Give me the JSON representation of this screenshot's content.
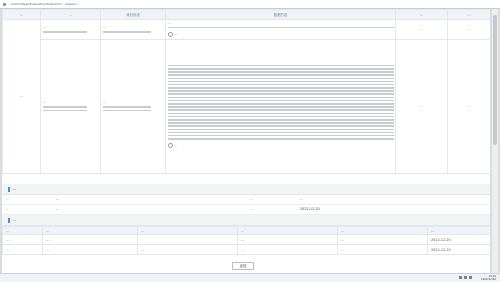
{
  "browser": {
    "url": "…/AdminPage/Evaluation/Detail?id=…&type=…"
  },
  "table1": {
    "headers": [
      "…",
      "…",
      "评分办法",
      "检测方法",
      "…",
      "…"
    ],
    "row1": {
      "no": "…",
      "item": "…",
      "standard": "…",
      "detail": "…",
      "status": "…",
      "score": "…",
      "choice": "…"
    },
    "row2": {
      "category": "…",
      "item": "…",
      "standard": "…",
      "status": "…",
      "score": "…",
      "choice": "…"
    }
  },
  "section_info": {
    "title": "…",
    "labels": [
      "…",
      "…",
      "…",
      "…"
    ],
    "values": [
      "…",
      "…",
      "…",
      "2022-12-20"
    ]
  },
  "section_records": {
    "title": "…",
    "headers": [
      "…",
      "…",
      "…",
      "…",
      "…",
      "…"
    ],
    "rows": [
      {
        "c1": "…",
        "c2": "…",
        "c3": "",
        "c4": "…",
        "c5": "…",
        "c6": "2022-12-20"
      },
      {
        "c1": "…",
        "c2": "…",
        "c3": "…",
        "c4": "…",
        "c5": "…",
        "c6": "2022-12-20"
      }
    ]
  },
  "back_button": {
    "label": "返回"
  },
  "taskbar": {
    "time": "19:49",
    "date": "2022/12/20"
  }
}
